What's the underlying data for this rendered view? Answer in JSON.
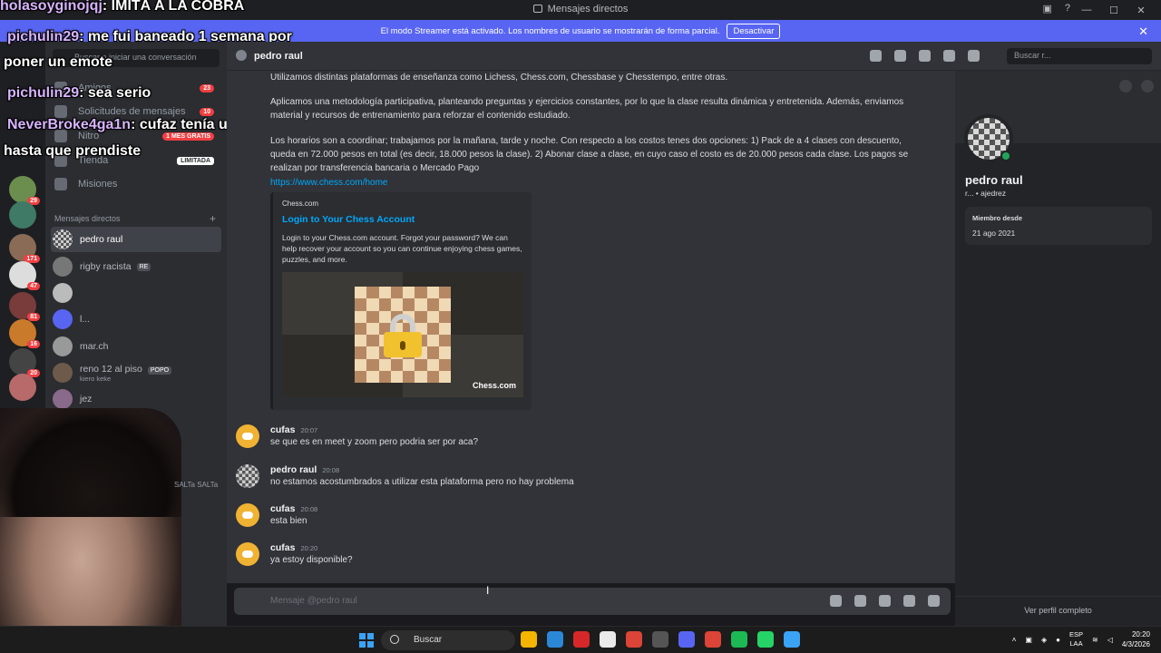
{
  "window": {
    "title": "Mensajes directos"
  },
  "streamer_bar": {
    "text": "El modo Streamer está activado. Los nombres de usuario se mostrarán de forma parcial.",
    "button": "Desactivar"
  },
  "guild_badges": [
    "29",
    "171",
    "47",
    "81",
    "16",
    "20"
  ],
  "sidebar": {
    "search_placeholder": "Buscar o iniciar una conversación",
    "items": [
      {
        "label": "Amigos",
        "badge": "23"
      },
      {
        "label": "Solicitudes de mensajes",
        "badge": "10"
      },
      {
        "label": "Nitro",
        "tag": "1 MES GRATIS"
      },
      {
        "label": "Tienda",
        "tag": "LIMITADA"
      },
      {
        "label": "Misiones"
      }
    ],
    "dm_header": "Mensajes directos",
    "dms": [
      {
        "name": "pedro raul"
      },
      {
        "name": "rigby racista",
        "chip": "RE"
      },
      {
        "name": ""
      },
      {
        "name": "l..."
      },
      {
        "name": "mar.ch"
      },
      {
        "name": "reno 12 al piso",
        "chip": "POPO",
        "sub": "kiero keke"
      },
      {
        "name": "jez"
      }
    ],
    "footer_text": "SALTa SALTa"
  },
  "overlay_chat": [
    {
      "user": "holasoyginojqj",
      "text": ": IMITÁ A LA COBRA"
    },
    {
      "user": "pichulin29",
      "text": ": me fui baneado 1 semana por"
    },
    {
      "user": "",
      "text": "poner un emote"
    },
    {
      "user": "pichulin29",
      "text": ": sea serio"
    },
    {
      "user": "NeverBroke4ga1n",
      "text": ": cufaz tenía un gran día"
    },
    {
      "user": "",
      "text": "hasta que prendiste"
    }
  ],
  "chat_header": {
    "name": "pedro raul",
    "search_placeholder": "Buscar r..."
  },
  "chat": {
    "paragraphs": [
      "Utilizamos distintas plataformas de enseñanza como Lichess, Chess.com, Chessbase y Chesstempo, entre otras.",
      "Aplicamos una metodología participativa, planteando preguntas y ejercicios constantes, por lo que la clase resulta dinámica y entretenida. Además, enviamos material y recursos de entrenamiento para reforzar el contenido estudiado.",
      "Los horarios son a coordinar; trabajamos por la mañana, tarde y noche. Con respecto a los costos tenes dos opciones: 1) Pack de a 4 clases  con descuento, queda en 72.000 pesos en total (es decir, 18.000 pesos la clase). 2) Abonar clase a clase, en cuyo caso el costo es de 20.000 pesos cada clase.  Los pagos se realizan por transferencia bancaria o Mercado Pago"
    ],
    "link": "https://www.chess.com/home",
    "embed": {
      "provider": "Chess.com",
      "title": "Login to Your Chess Account",
      "description": "Login to your Chess.com account. Forgot your password? We can help recover your account so you can continue enjoying chess games, puzzles, and more.",
      "brand": "Chess.com"
    },
    "messages": [
      {
        "author": "cufas",
        "time": "20:07",
        "text": "se que es en meet y zoom pero podria ser por aca?"
      },
      {
        "author": "pedro raul",
        "time": "20:08",
        "text": "no estamos acostumbrados a utilizar esta plataforma pero no hay problema"
      },
      {
        "author": "cufas",
        "time": "20:08",
        "text": "esta bien"
      },
      {
        "author": "cufas",
        "time": "20:20",
        "text": "ya estoy disponible?"
      }
    ],
    "composer_placeholder": "Mensaje @pedro raul"
  },
  "profile": {
    "name": "pedro raul",
    "tag": "r... • ajedrez",
    "member_since_label": "Miembro desde",
    "member_since": "21 ago 2021",
    "view_full": "Ver perfil completo"
  },
  "taskbar": {
    "search": "Buscar",
    "lang_top": "ESP",
    "lang_bottom": "LAA",
    "time": "20:20",
    "date": "4/3/2026"
  },
  "colors": {
    "accent": "#5865f2",
    "link": "#00a8fc",
    "online": "#23a559"
  }
}
